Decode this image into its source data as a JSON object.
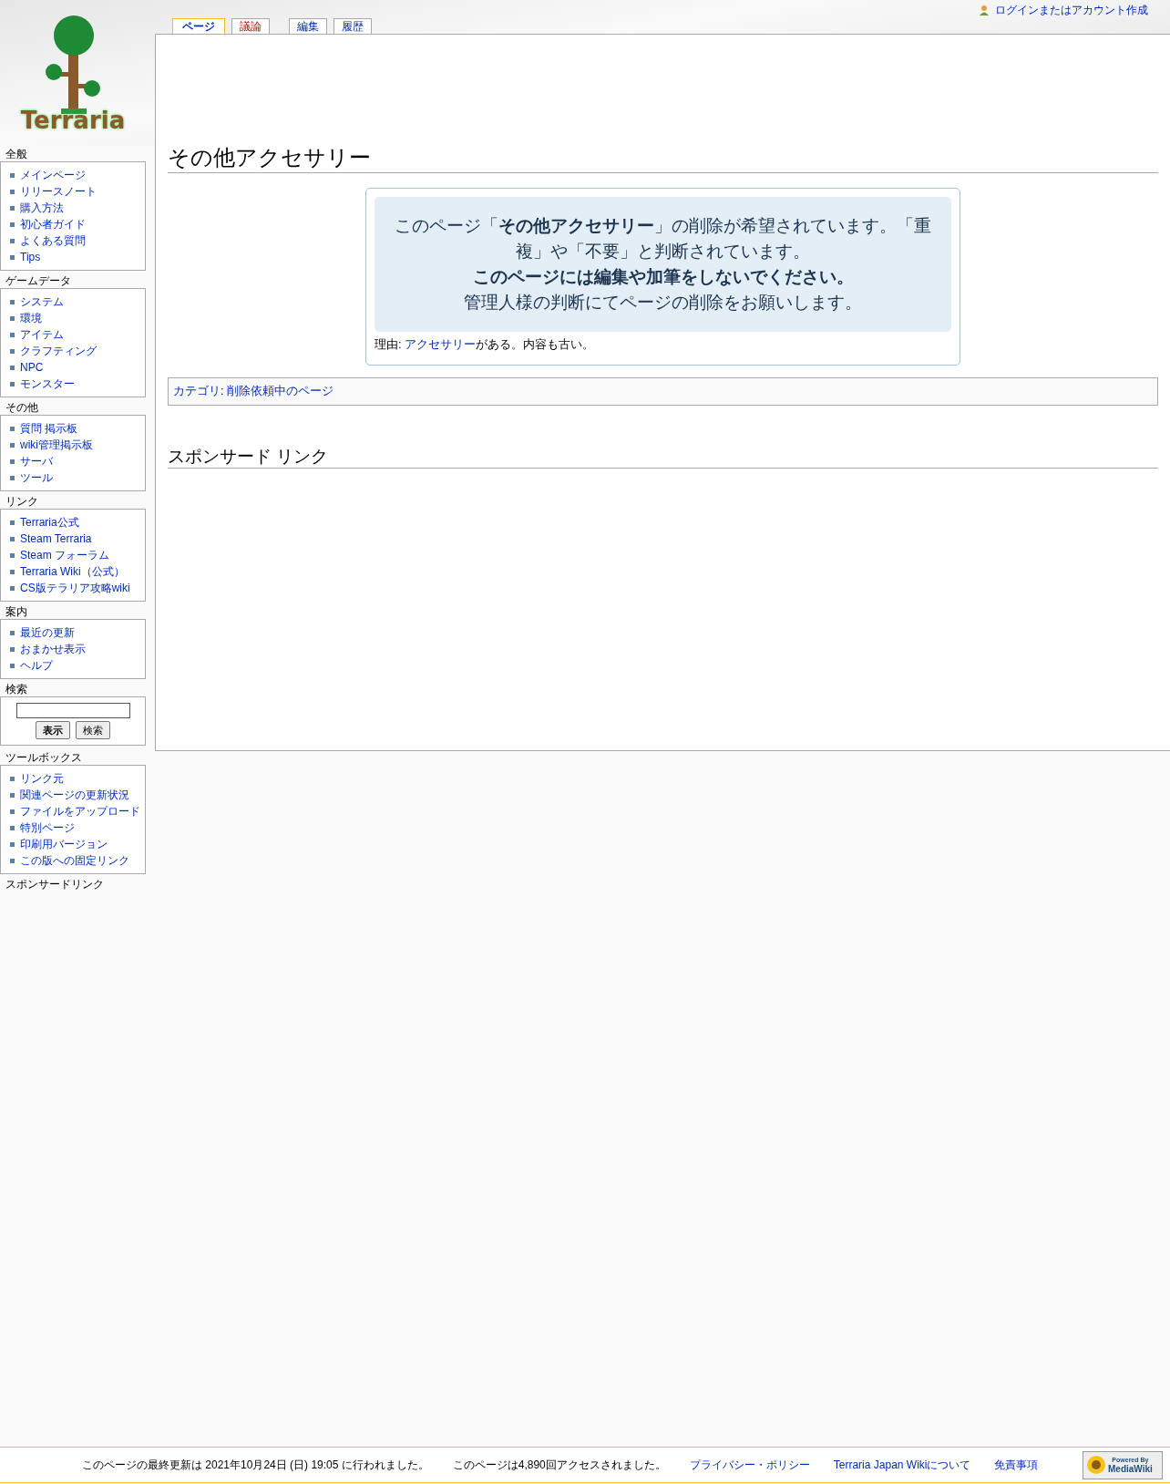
{
  "logo": {
    "text": "Terraria"
  },
  "personal": {
    "login": "ログインまたはアカウント作成"
  },
  "tabs": [
    {
      "label": "ページ",
      "selected": true,
      "missing": false
    },
    {
      "label": "議論",
      "selected": false,
      "missing": true
    },
    {
      "label": "編集",
      "selected": false,
      "missing": false
    },
    {
      "label": "履歴",
      "selected": false,
      "missing": false
    }
  ],
  "sidebar": [
    {
      "kind": "links",
      "heading": "全般",
      "items": [
        "メインページ",
        "リリースノート",
        "購入方法",
        "初心者ガイド",
        "よくある質問",
        "Tips"
      ]
    },
    {
      "kind": "links",
      "heading": "ゲームデータ",
      "items": [
        "システム",
        "環境",
        "アイテム",
        "クラフティング",
        "NPC",
        "モンスター"
      ]
    },
    {
      "kind": "links",
      "heading": "その他",
      "items": [
        "質問 掲示板",
        "wiki管理掲示板",
        "サーバ",
        "ツール"
      ]
    },
    {
      "kind": "links",
      "heading": "リンク",
      "items": [
        "Terraria公式",
        "Steam Terraria",
        "Steam フォーラム",
        "Terraria Wiki（公式）",
        "CS版テラリア攻略wiki"
      ]
    },
    {
      "kind": "links",
      "heading": "案内",
      "items": [
        "最近の更新",
        "おまかせ表示",
        "ヘルプ"
      ]
    },
    {
      "kind": "search",
      "heading": "検索",
      "buttons": [
        "表示",
        "検索"
      ]
    },
    {
      "kind": "links",
      "heading": "ツールボックス",
      "items": [
        "リンク元",
        "関連ページの更新状況",
        "ファイルをアップロード",
        "特別ページ",
        "印刷用バージョン",
        "この版への固定リンク"
      ]
    },
    {
      "kind": "heading_only",
      "heading": "スポンサードリンク"
    }
  ],
  "page": {
    "title": "その他アクセサリー",
    "notice": {
      "lines": [
        "このページ「**その他アクセサリー**」の削除が希望されています。「重複」や「不要」と判断されています。",
        "**このページには編集や加筆をしないでください。**",
        "管理人様の判断にてページの削除をお願いします。"
      ],
      "reason_label": "理由: ",
      "reason_link": "アクセサリー",
      "reason_rest": "がある。内容も古い。"
    },
    "categories": {
      "label": "カテゴリ",
      "separator": ": ",
      "items": [
        "削除依頼中のページ"
      ]
    },
    "sponsored_heading": "スポンサード リンク"
  },
  "footer": {
    "items": [
      "このページの最終更新は 2021年10月24日 (日) 19:05 に行われました。",
      "このページは4,890回アクセスされました。"
    ],
    "links": [
      "プライバシー・ポリシー",
      "Terraria Japan Wikiについて",
      "免責事項"
    ],
    "badge_top": "Powered By",
    "badge_bottom": "MediaWiki"
  }
}
